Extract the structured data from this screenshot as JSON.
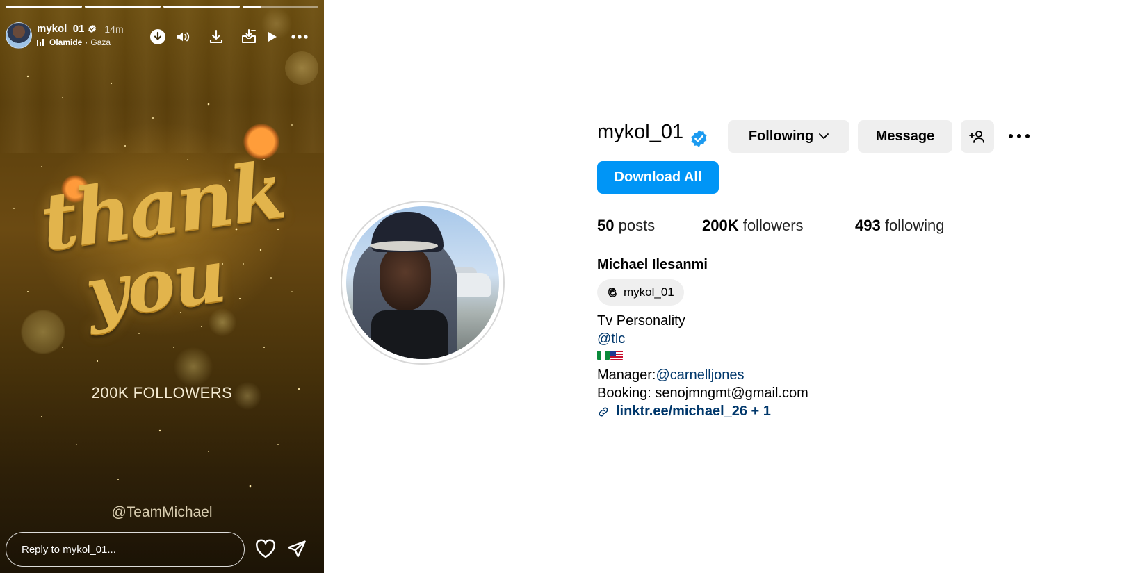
{
  "story": {
    "progress_fractions": [
      1,
      1,
      1,
      0.25
    ],
    "username": "mykol_01",
    "time_ago": "14m",
    "music": {
      "artist": "Olamide",
      "song": "Gaza"
    },
    "headline_line1": "thank",
    "headline_line2": "you",
    "caption": "200K FOLLOWERS",
    "watermark": "@TeamMichael",
    "reply_placeholder": "Reply to mykol_01...",
    "icons": [
      "download-icon",
      "volume-icon",
      "save-icon",
      "save-to-archive-icon",
      "play-icon",
      "more-icon",
      "heart-icon",
      "send-icon"
    ]
  },
  "profile": {
    "username": "mykol_01",
    "verified": true,
    "buttons": {
      "following": "Following",
      "message": "Message",
      "download_all": "Download All"
    },
    "stats": {
      "posts_count": "50",
      "posts_label": " posts",
      "followers_count": "200K",
      "followers_label": " followers",
      "following_count": "493",
      "following_label": " following"
    },
    "full_name": "Michael Ilesanmi",
    "threads_handle": "mykol_01",
    "bio": {
      "line1": "Tv Personality",
      "line2_link": "@tlc",
      "flags": [
        "nigeria-flag",
        "usa-flag"
      ],
      "manager_label": "Manager:",
      "manager_link": "@carnelljones",
      "booking_label": "Booking: ",
      "booking_email": "senojmngmt@gmail.com",
      "external_link": "linktr.ee/michael_26 + 1"
    },
    "colors": {
      "primary_button": "#0095f6",
      "verified_badge": "#1d9bf0",
      "link": "#00376b",
      "grey_button": "#efefef"
    }
  }
}
